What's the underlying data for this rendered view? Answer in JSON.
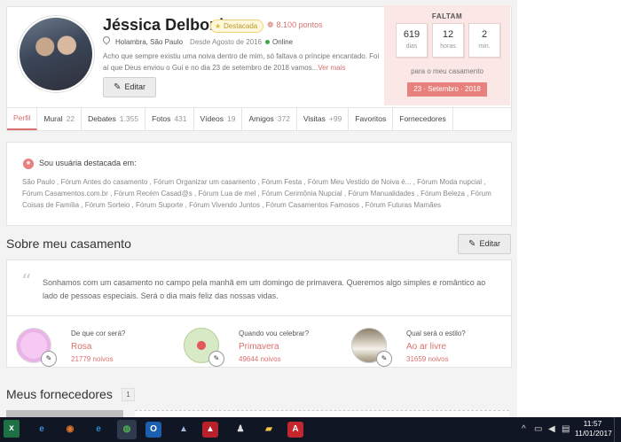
{
  "profile": {
    "name": "Jéssica Delboni",
    "featured_badge": "Destacada",
    "points": "8.100 pontos",
    "location": "Holambra, São Paulo",
    "since": "Desde Agosto de 2016",
    "status": "Online",
    "bio": "Acho que sempre existiu uma noiva dentro de mim, só faltava o príncipe encantado. Foi aí que Deus enviou o Gui e no dia 23 de setembro de 2018 vamos...",
    "read_more": "Ver mais",
    "edit_label": "Editar"
  },
  "countdown": {
    "title": "FALTAM",
    "days": "619",
    "days_label": "dias",
    "hours": "12",
    "hours_label": "horas",
    "minutes": "2",
    "minutes_label": "min.",
    "subtitle": "para o meu casamento",
    "date": "23 · Setembro · 2018"
  },
  "tabs": [
    {
      "label": "Perfil",
      "count": ""
    },
    {
      "label": "Mural",
      "count": "22"
    },
    {
      "label": "Debates",
      "count": "1.355"
    },
    {
      "label": "Fotos",
      "count": "431"
    },
    {
      "label": "Vídeos",
      "count": "19"
    },
    {
      "label": "Amigos",
      "count": "372"
    },
    {
      "label": "Visitas",
      "count": "+99"
    },
    {
      "label": "Favoritos",
      "count": ""
    },
    {
      "label": "Fornecedores",
      "count": ""
    }
  ],
  "featured": {
    "title": "Sou usuária destacada em:",
    "forums": "São Paulo , Fórum Antes do casamento , Fórum Organizar um casamento , Fórum Festa , Fórum Meu Vestido de Noiva é... , Fórum Moda nupcial , Fórum Casamentos.com.br , Fórum Recém Casad@s , Fórum Lua de mel , Fórum Cerimônia Nupcial , Fórum Manualidades , Fórum Beleza , Fórum Coisas de Família , Fórum Sorteio , Fórum Suporte , Fórum Vivendo Juntos , Fórum Casamentos Famosos , Fórum Futuras Mamães"
  },
  "wedding": {
    "section_title": "Sobre meu casamento",
    "edit_label": "Editar",
    "quote": "Sonhamos com um casamento no campo pela manhã em um domingo de primavera. Queremos algo simples e romântico ao lado de pessoas especiais. Será o dia mais feliz das nossas vidas.",
    "features": [
      {
        "question": "De que cor será?",
        "answer": "Rosa",
        "count": "21779 noivos"
      },
      {
        "question": "Quando vou celebrar?",
        "answer": "Primavera",
        "count": "49644 noivos"
      },
      {
        "question": "Qual será o estilo?",
        "answer": "Ao ar livre",
        "count": "31659 noivos"
      }
    ]
  },
  "suppliers": {
    "title": "Meus fornecedores",
    "count": "1"
  },
  "taskbar": {
    "time": "11:57",
    "date": "11/01/2017"
  },
  "colors": {
    "accent": "#d9716f",
    "countdown_bg": "#fbe8e6",
    "online": "#3aa845"
  }
}
